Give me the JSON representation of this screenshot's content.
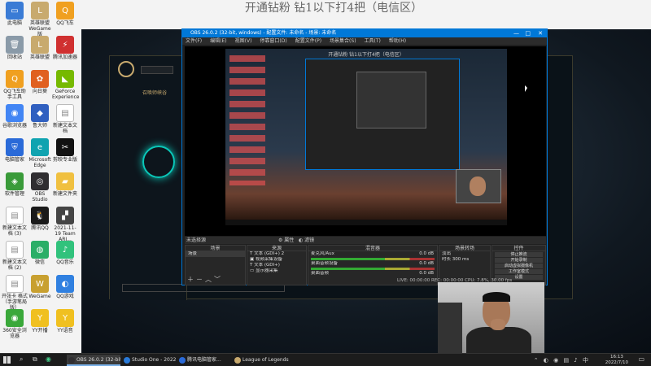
{
  "banner": "开通钻粉 钻1以下打4把（电信区）",
  "desktop_icons": [
    {
      "label": "此电脑",
      "color": "#3a7bd5",
      "glyph": "▭"
    },
    {
      "label": "英雄联盟 WeGame版",
      "color": "#c8aa6e",
      "glyph": "L"
    },
    {
      "label": "QQ飞车",
      "color": "#f0a020",
      "glyph": "Q"
    },
    {
      "label": "回收站",
      "color": "#8a9aa8",
      "glyph": "🗑"
    },
    {
      "label": "英雄联盟",
      "color": "#c8aa6e",
      "glyph": "L"
    },
    {
      "label": "腾讯加速器",
      "color": "#d03030",
      "glyph": "⚡"
    },
    {
      "label": "QQ飞车助手工具",
      "color": "#f0a020",
      "glyph": "Q"
    },
    {
      "label": "向日葵",
      "color": "#e06020",
      "glyph": "✿"
    },
    {
      "label": "GeForce Experience",
      "color": "#76b900",
      "glyph": "◣"
    },
    {
      "label": "谷歌浏览器",
      "color": "#4285f4",
      "glyph": "◉"
    },
    {
      "label": "鲁大师",
      "color": "#3060c0",
      "glyph": "◆"
    },
    {
      "label": "新建文本文档",
      "color": "#ffffff",
      "glyph": "▤"
    },
    {
      "label": "电脑管家",
      "color": "#2a6ad8",
      "glyph": "⛨"
    },
    {
      "label": "Microsoft Edge",
      "color": "#0fa3b0",
      "glyph": "e"
    },
    {
      "label": "剪映专业版",
      "color": "#111111",
      "glyph": "✂"
    },
    {
      "label": "软件管理",
      "color": "#3a9b3a",
      "glyph": "◈"
    },
    {
      "label": "OBS Studio",
      "color": "#302e31",
      "glyph": "◎"
    },
    {
      "label": "新建文件夹",
      "color": "#f0c040",
      "glyph": "▰"
    },
    {
      "label": "新建文本文档 (3)",
      "color": "#ffffff",
      "glyph": "▤"
    },
    {
      "label": "腾讯QQ",
      "color": "#1a1a1a",
      "glyph": "🐧"
    },
    {
      "label": "2021-11-19 Team ARI...",
      "color": "#444444",
      "glyph": "▞"
    },
    {
      "label": "新建文本文档 (2)",
      "color": "#ffffff",
      "glyph": "▤"
    },
    {
      "label": "微信",
      "color": "#2aae67",
      "glyph": "◍"
    },
    {
      "label": "QQ音乐",
      "color": "#31c27c",
      "glyph": "♪"
    },
    {
      "label": "开张卡 格式（手游笔局版）",
      "color": "#ffffff",
      "glyph": "▤"
    },
    {
      "label": "WeGame",
      "color": "#c8a030",
      "glyph": "W"
    },
    {
      "label": "QQ游戏",
      "color": "#3080e0",
      "glyph": "◐"
    },
    {
      "label": "360安全浏览器",
      "color": "#3aa83a",
      "glyph": "◉"
    },
    {
      "label": "YY开播",
      "color": "#f0c020",
      "glyph": "Y"
    },
    {
      "label": "YY语音",
      "color": "#f0c020",
      "glyph": "Y"
    }
  ],
  "obs": {
    "title": "OBS 26.0.2 (32-bit, windows) - 配置文件: 未命名 - 场景: 未命名",
    "menu": [
      "文件(F)",
      "编辑(E)",
      "视图(V)",
      "停靠窗口(D)",
      "配置文件(P)",
      "场景集合(S)",
      "工具(T)",
      "帮助(H)"
    ],
    "mini_banner": "开通钻粉 钻1以下打4把（电信区）",
    "source_label": "未选择源",
    "properties_label": "属性",
    "filters_label": "滤镜",
    "docks": {
      "scenes": {
        "header": "场景",
        "items": [
          "场景"
        ]
      },
      "sources": {
        "header": "来源",
        "items": [
          "文本 (GDI+) 2",
          "视频采集设备",
          "文本 (GDI+)",
          "显示器采集"
        ]
      },
      "mixer": {
        "header": "混音器",
        "items": [
          {
            "name": "麦克风/Aux",
            "level": "0.0 dB"
          },
          {
            "name": "桌面音频设备",
            "level": "0.0 dB"
          },
          {
            "name": "桌面音频",
            "level": "0.0 dB"
          }
        ]
      },
      "transitions": {
        "header": "场景转场",
        "type": "淡出",
        "duration_label": "时长",
        "duration": "300 ms"
      },
      "controls": {
        "header": "控件",
        "buttons": [
          "停止推流",
          "开始录制",
          "启动虚拟摄像机",
          "工作室模式",
          "设置",
          "退出"
        ]
      }
    },
    "status": "LIVE: 00:00:00   REC: 00:00:00   CPU: 7.8%, 30.00 fps"
  },
  "taskbar": {
    "items": [
      {
        "label": "OBS 26.0.2 (32-bit...",
        "color": "#302e31"
      },
      {
        "label": "Studio One - 2022...",
        "color": "#2a7ad8"
      },
      {
        "label": "腾讯电脑管家...",
        "color": "#2a6ad8"
      },
      {
        "label": "League of Legends",
        "color": "#c8aa6e"
      }
    ],
    "time": "16:13",
    "date": "2022/7/10",
    "ime": "中"
  },
  "lol": {
    "tab_label": "召唤师峡谷"
  }
}
